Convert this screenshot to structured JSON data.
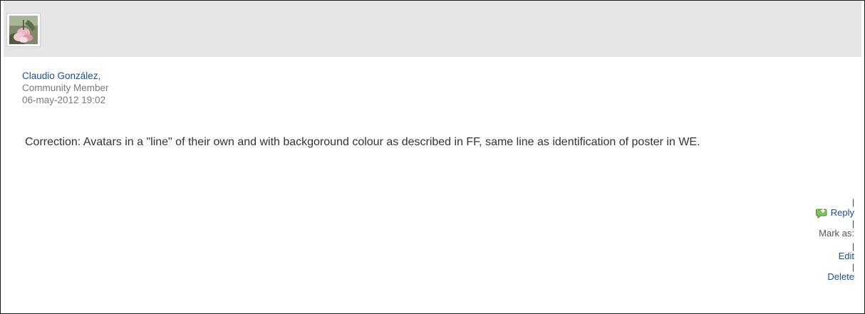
{
  "post": {
    "author_name": "Claudio González",
    "author_comma": ",",
    "author_role": "Community Member",
    "timestamp": "06-may-2012 19:02",
    "body": "Correction: Avatars in a \"line\" of their own and with backgoround colour as described in FF, same line as identification of poster in WE."
  },
  "actions": {
    "separator": "|",
    "reply_label": "Reply",
    "mark_as_label": "Mark as:",
    "edit_label": "Edit",
    "delete_label": "Delete"
  },
  "icons": {
    "avatar": "flower-avatar-image",
    "reply": "reply-speech-bubble-icon"
  },
  "colors": {
    "link": "#1f4e8c",
    "avatar_bar": "#e6e6e6",
    "reply_icon": "#5ca33a"
  }
}
